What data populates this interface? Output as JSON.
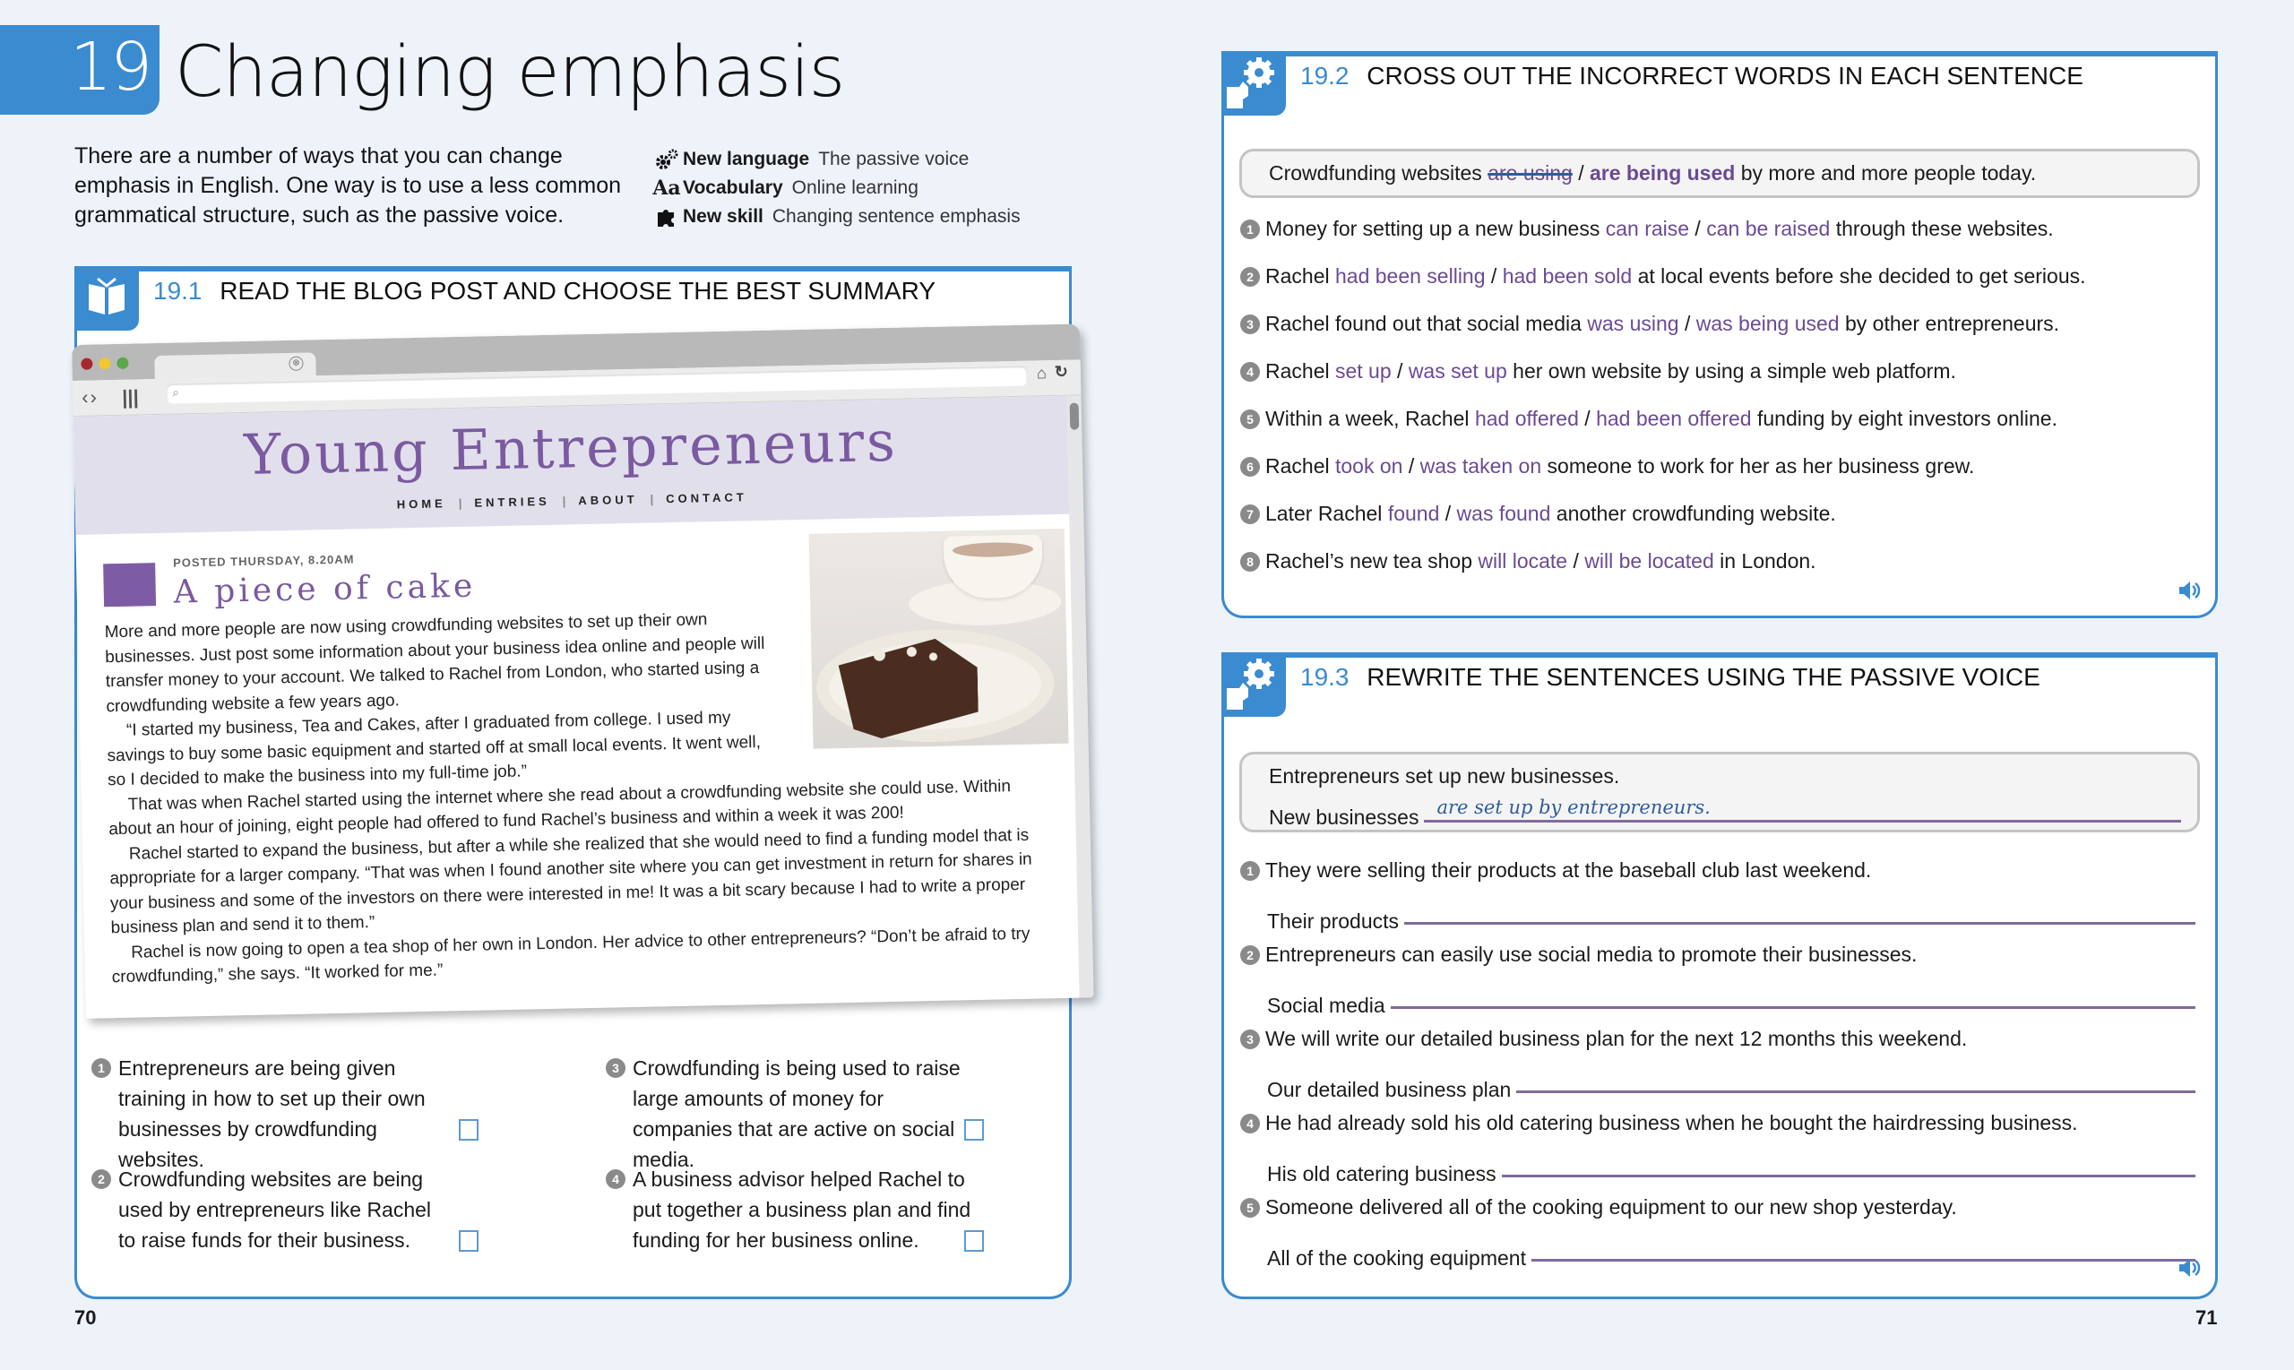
{
  "header": {
    "chapter_number": "19",
    "title": "Changing emphasis",
    "intro": "There are a number of ways that you can change emphasis in English. One way is to use a less common grammatical structure, such as the passive voice.",
    "meta": [
      {
        "icon": "gears-icon",
        "key": "New language",
        "value": "The passive voice"
      },
      {
        "icon": "aa-icon",
        "key": "Vocabulary",
        "value": "Online learning"
      },
      {
        "icon": "puzzle-icon",
        "key": "New skill",
        "value": "Changing sentence emphasis"
      }
    ]
  },
  "ex191": {
    "number": "19.1",
    "title": "READ THE BLOG POST AND CHOOSE THE BEST SUMMARY",
    "icon": "book-icon",
    "browser": {
      "tab_close": "⊗",
      "nav": "‹›",
      "menu": "|||",
      "search_icon": "⌕",
      "home_icon": "⌂",
      "reload_icon": "↻"
    },
    "blog": {
      "name": "Young Entrepreneurs",
      "nav": [
        "HOME",
        "ENTRIES",
        "ABOUT",
        "CONTACT"
      ],
      "posted": "POSTED THURSDAY, 8.20AM",
      "post_title": "A piece of cake",
      "paragraphs": [
        "More and more people are now using crowdfunding websites to set up their own businesses. Just post some information about your business idea online and people will transfer money to your account. We talked to Rachel from London, who started using a crowdfunding website a few years ago.",
        "“I started my business, Tea and Cakes, after I graduated from college. I used my savings to buy some basic equipment and started off at small local events. It went well, so I decided to make the business into my full-time job.”",
        "That was when Rachel started using the internet where she read about a crowdfunding website she could use. Within about an hour of joining, eight people had offered to fund Rachel’s business and within a week it was 200!",
        "Rachel started to expand the business, but after a while she realized that she would need to find a funding model that is appropriate for a larger company. “That was when I found another site where you can get investment in return for shares in your business and some of the investors on there were interested in me! It was a bit scary because I had to write a proper business plan and send it to them.”",
        "Rachel is now going to open a tea shop of her own in London. Her advice to other entrepreneurs? “Don’t be afraid to try crowdfunding,” she says. “It worked for me.”"
      ]
    },
    "options": [
      {
        "num": "1",
        "text": "Entrepreneurs are being given training in how to set up their own businesses by crowdfunding websites.",
        "checked": false
      },
      {
        "num": "2",
        "text": "Crowdfunding websites are being used by entrepreneurs like Rachel to raise funds for their business.",
        "checked": false
      },
      {
        "num": "3",
        "text": "Crowdfunding is being used to raise large amounts of money for companies that are active on social media.",
        "checked": false
      },
      {
        "num": "4",
        "text": "A business advisor helped Rachel to put together a business plan and find funding for her business online.",
        "checked": false
      }
    ]
  },
  "ex192": {
    "number": "19.2",
    "title": "CROSS OUT THE INCORRECT WORDS IN EACH SENTENCE",
    "icon": "gears-icon",
    "example": {
      "before": "Crowdfunding websites ",
      "wrong": "are using",
      "sep": " / ",
      "right": "are being used",
      "after": " by more and more people today."
    },
    "items": [
      {
        "num": "1",
        "before": "Money for setting up a new business ",
        "a": "can raise",
        "b": "can be raised",
        "after": " through these websites."
      },
      {
        "num": "2",
        "before": "Rachel ",
        "a": "had been selling",
        "b": "had been sold",
        "after": " at local events before she decided to get serious."
      },
      {
        "num": "3",
        "before": "Rachel found out that social media ",
        "a": "was using",
        "b": "was being used",
        "after": " by other entrepreneurs."
      },
      {
        "num": "4",
        "before": "Rachel ",
        "a": "set up",
        "b": "was set up",
        "after": " her own website by using a simple web platform."
      },
      {
        "num": "5",
        "before": "Within a week, Rachel ",
        "a": "had offered",
        "b": "had been offered",
        "after": " funding by eight investors online."
      },
      {
        "num": "6",
        "before": "Rachel ",
        "a": "took on",
        "b": "was taken on",
        "after": " someone to work for her as her business grew."
      },
      {
        "num": "7",
        "before": "Later Rachel ",
        "a": "found",
        "b": "was found",
        "after": " another crowdfunding website."
      },
      {
        "num": "8",
        "before": "Rachel’s new tea shop ",
        "a": "will locate",
        "b": "will be located",
        "after": " in London."
      }
    ],
    "sep": " / ",
    "audio_icon": "speaker-icon"
  },
  "ex193": {
    "number": "19.3",
    "title": "REWRITE THE SENTENCES USING THE PASSIVE VOICE",
    "icon": "gears-icon",
    "example": {
      "sentence": "Entrepreneurs set up new businesses.",
      "prompt": "New businesses",
      "answer": "are set up by entrepreneurs."
    },
    "items": [
      {
        "num": "1",
        "sentence": "They were selling their products at the baseball club last weekend.",
        "prompt": "Their products",
        "answer": ""
      },
      {
        "num": "2",
        "sentence": "Entrepreneurs can easily use social media to promote their businesses.",
        "prompt": "Social media",
        "answer": ""
      },
      {
        "num": "3",
        "sentence": "We will write our detailed business plan for the next 12 months this weekend.",
        "prompt": "Our detailed business plan",
        "answer": ""
      },
      {
        "num": "4",
        "sentence": "He had already sold his old catering business when he bought the hairdressing business.",
        "prompt": "His old catering business",
        "answer": ""
      },
      {
        "num": "5",
        "sentence": "Someone delivered all of the cooking equipment to our new shop yesterday.",
        "prompt": "All of the cooking equipment",
        "answer": ""
      }
    ],
    "audio_icon": "speaker-icon"
  },
  "pages": {
    "left": "70",
    "right": "71"
  },
  "colors": {
    "accent": "#3b8bd0",
    "choice": "#6a4a94",
    "blog_purple": "#7a5aa0"
  }
}
